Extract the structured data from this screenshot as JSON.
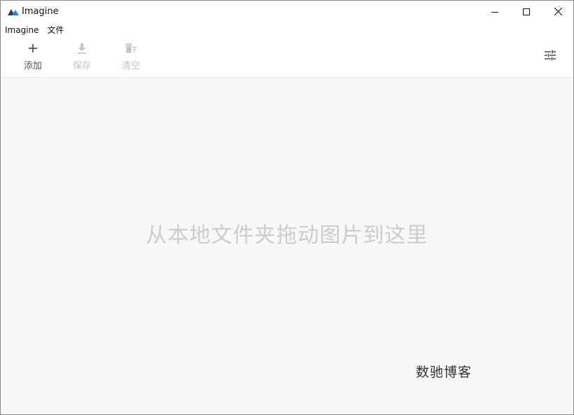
{
  "window": {
    "title": "Imagine",
    "controls": [
      "minimize",
      "maximize",
      "close"
    ]
  },
  "menu": [
    {
      "label": "Imagine"
    },
    {
      "label": "文件"
    }
  ],
  "toolbar": {
    "add": {
      "label": "添加",
      "icon": "plus-icon",
      "enabled": true
    },
    "save": {
      "label": "保存",
      "icon": "download-icon",
      "enabled": false
    },
    "clear": {
      "label": "清空",
      "icon": "clear-all-icon",
      "enabled": false
    },
    "settings": {
      "icon": "sliders-icon"
    }
  },
  "main": {
    "drop_hint": "从本地文件夹拖动图片到这里"
  },
  "watermark": "数驰博客",
  "colors": {
    "logo_dark": "#2c3e50",
    "logo_accent": "#1e88e5",
    "content_bg": "#f9f8f7",
    "hint_text": "#cccccc",
    "disabled": "#c2c2c2"
  }
}
